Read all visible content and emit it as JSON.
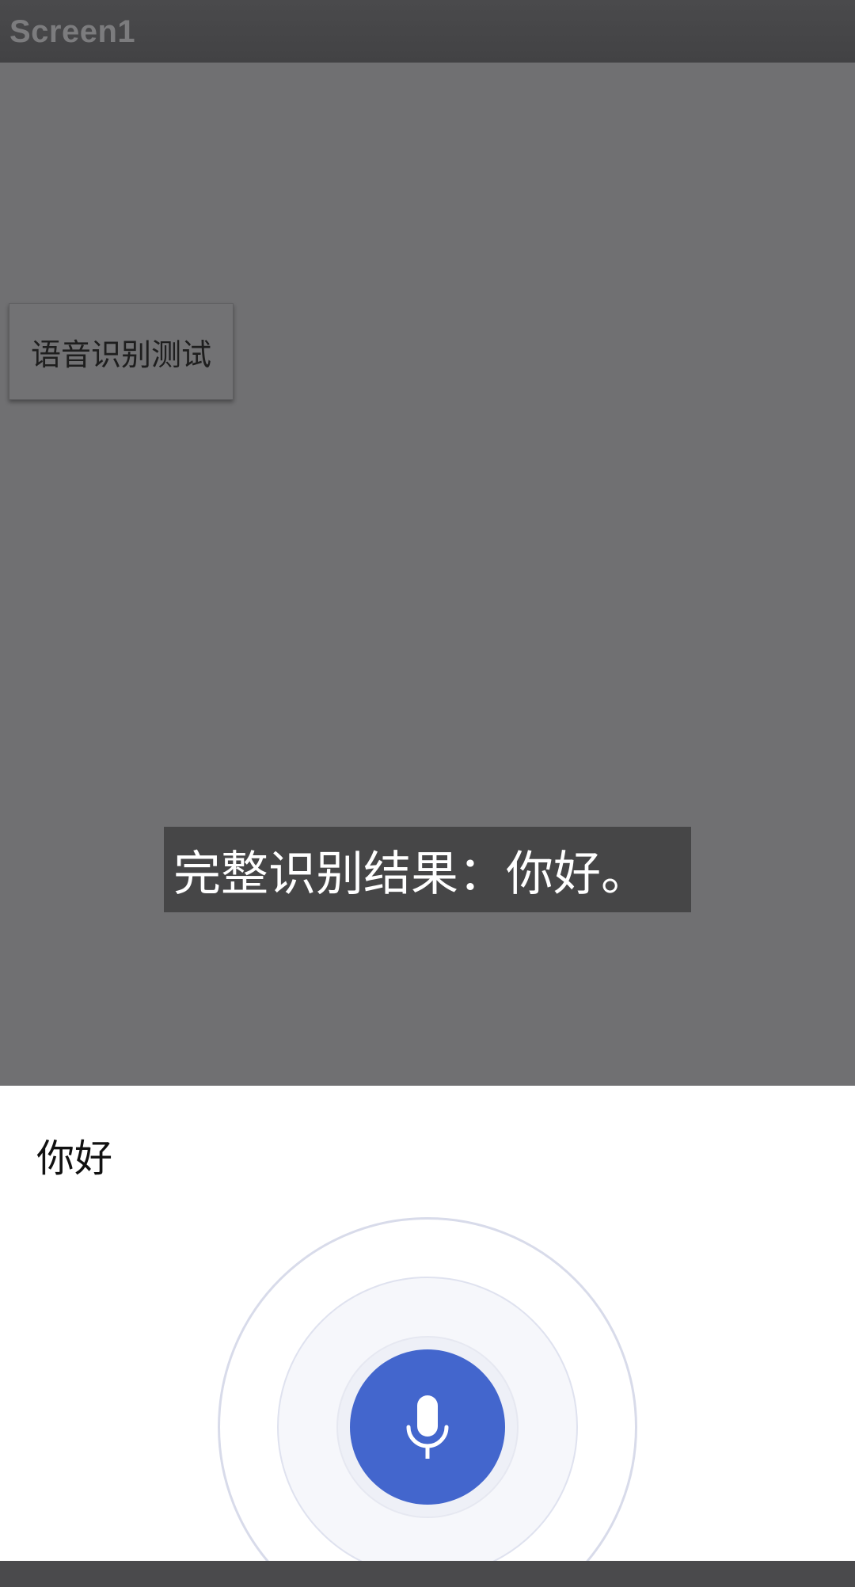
{
  "titlebar": {
    "title": "Screen1"
  },
  "main": {
    "test_button_label": "语音识别测试",
    "result_text": "完整识别结果：你好。"
  },
  "speech_dialog": {
    "partial_text": "你好",
    "mic_color": "#4366cd"
  }
}
